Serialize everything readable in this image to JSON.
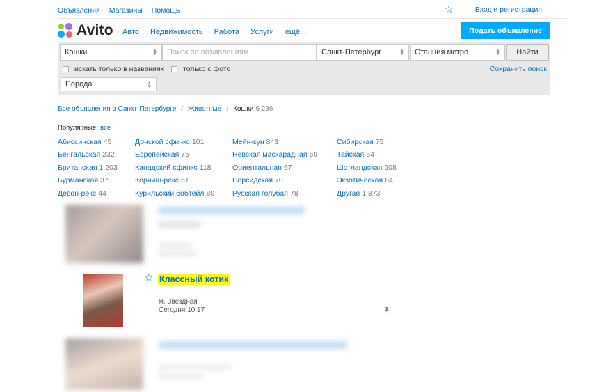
{
  "header": {
    "top_links": [
      "Объявления",
      "Магазины",
      "Помощь"
    ],
    "login": "Вход и регистрация",
    "logo": "Avito",
    "nav": [
      "Авто",
      "Недвижимость",
      "Работа",
      "Услуги",
      "ещё..."
    ],
    "post_button": "Подать объявление"
  },
  "search": {
    "category": "Кошки",
    "query_placeholder": "Поиск по объявлениям",
    "city": "Санкт-Петербург",
    "metro": "Станция метро",
    "find_button": "Найти",
    "only_titles": "искать только в названиях",
    "only_photo": "только с фото",
    "save_search": "Сохранить поиск",
    "breed": "Порода"
  },
  "breadcrumbs": {
    "items": [
      "Все объявления в Санкт-Петербурге",
      "Животные"
    ],
    "current": "Кошки",
    "count": "6 236"
  },
  "popular": {
    "label": "Популярные",
    "all": "все",
    "columns": [
      [
        {
          "name": "Абиссинская",
          "count": "45"
        },
        {
          "name": "Бенгальская",
          "count": "232"
        },
        {
          "name": "Британская",
          "count": "1 203"
        },
        {
          "name": "Бурманская",
          "count": "37"
        },
        {
          "name": "Девон-рекс",
          "count": "44"
        }
      ],
      [
        {
          "name": "Донской сфинкс",
          "count": "101"
        },
        {
          "name": "Европейская",
          "count": "75"
        },
        {
          "name": "Канадский сфинкс",
          "count": "118"
        },
        {
          "name": "Корниш-рекс",
          "count": "61"
        },
        {
          "name": "Курильский бобтейл",
          "count": "80"
        }
      ],
      [
        {
          "name": "Мейн-кун",
          "count": "843"
        },
        {
          "name": "Невская маскарадная",
          "count": "69"
        },
        {
          "name": "Ориентальная",
          "count": "67"
        },
        {
          "name": "Персидская",
          "count": "70"
        },
        {
          "name": "Русская голубая",
          "count": "78"
        }
      ],
      [
        {
          "name": "Сибирская",
          "count": "75"
        },
        {
          "name": "Тайская",
          "count": "64"
        },
        {
          "name": "Шотландская",
          "count": "908"
        },
        {
          "name": "Экзотическая",
          "count": "64"
        },
        {
          "name": "Другая",
          "count": "1 873"
        }
      ]
    ]
  },
  "listing": {
    "title": "Классный котик",
    "metro": "м. Звездная",
    "time": "Сегодня 10:17"
  },
  "colors": {
    "accent": "#00aaff",
    "link": "#0b6fb7",
    "highlight": "#fdf71a"
  },
  "icons": {
    "favorite": "star-outline-icon",
    "dropdown": "updown-arrow-icon",
    "pin": "pin-icon"
  }
}
